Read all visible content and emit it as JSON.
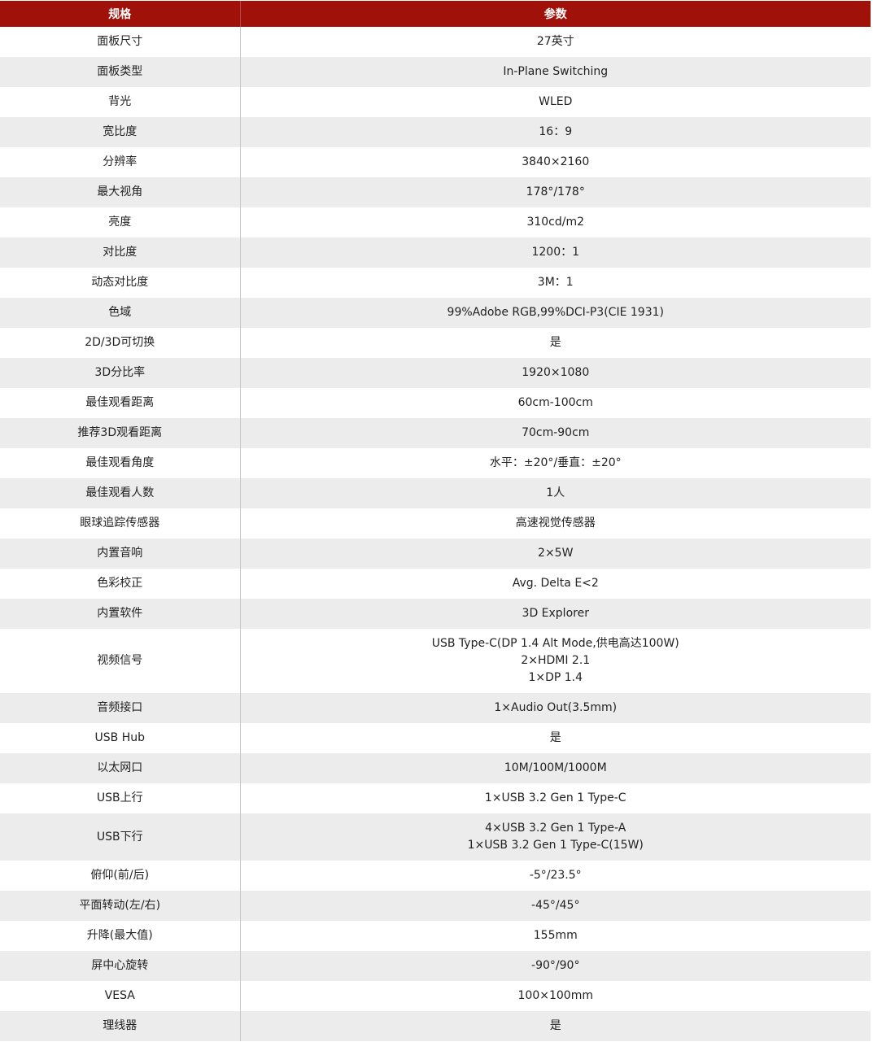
{
  "header": {
    "spec": "规格",
    "param": "参数"
  },
  "colors": {
    "header_bg": "#a01109",
    "alt_row_bg": "#ececec"
  },
  "rows": [
    {
      "label": "面板尺寸",
      "values": [
        "27英寸"
      ]
    },
    {
      "label": "面板类型",
      "values": [
        "In-Plane Switching"
      ]
    },
    {
      "label": "背光",
      "values": [
        "WLED"
      ]
    },
    {
      "label": "宽比度",
      "values": [
        "16：9"
      ]
    },
    {
      "label": "分辨率",
      "values": [
        "3840×2160"
      ]
    },
    {
      "label": "最大视角",
      "values": [
        "178°/178°"
      ]
    },
    {
      "label": "亮度",
      "values": [
        "310cd/m2"
      ]
    },
    {
      "label": "对比度",
      "values": [
        "1200：1"
      ]
    },
    {
      "label": "动态对比度",
      "values": [
        "3M：1"
      ]
    },
    {
      "label": "色域",
      "values": [
        "99%Adobe RGB,99%DCI-P3(CIE 1931)"
      ]
    },
    {
      "label": "2D/3D可切换",
      "values": [
        "是"
      ]
    },
    {
      "label": "3D分比率",
      "values": [
        "1920×1080"
      ]
    },
    {
      "label": "最佳观看距离",
      "values": [
        "60cm-100cm"
      ]
    },
    {
      "label": "推荐3D观看距离",
      "values": [
        "70cm-90cm"
      ]
    },
    {
      "label": "最佳观看角度",
      "values": [
        "水平：±20°/垂直：±20°"
      ]
    },
    {
      "label": "最佳观看人数",
      "values": [
        "1人"
      ]
    },
    {
      "label": "眼球追踪传感器",
      "values": [
        "高速视觉传感器"
      ]
    },
    {
      "label": "内置音响",
      "values": [
        "2×5W"
      ]
    },
    {
      "label": "色彩校正",
      "values": [
        "Avg. Delta E<2"
      ]
    },
    {
      "label": "内置软件",
      "values": [
        "3D Explorer"
      ]
    },
    {
      "label": "视频信号",
      "values": [
        "USB Type-C(DP 1.4 Alt Mode,供电高达100W)",
        "2×HDMI 2.1",
        "1×DP 1.4"
      ]
    },
    {
      "label": "音频接口",
      "values": [
        "1×Audio Out(3.5mm)"
      ]
    },
    {
      "label": "USB Hub",
      "values": [
        "是"
      ]
    },
    {
      "label": "以太网口",
      "values": [
        "10M/100M/1000M"
      ]
    },
    {
      "label": "USB上行",
      "values": [
        "1×USB 3.2 Gen 1 Type-C"
      ]
    },
    {
      "label": "USB下行",
      "values": [
        "4×USB 3.2 Gen 1 Type-A",
        "1×USB 3.2 Gen 1 Type-C(15W)"
      ]
    },
    {
      "label": "俯仰(前/后)",
      "values": [
        "-5°/23.5°"
      ]
    },
    {
      "label": "平面转动(左/右)",
      "values": [
        "-45°/45°"
      ]
    },
    {
      "label": "升降(最大值)",
      "values": [
        "155mm"
      ]
    },
    {
      "label": "屏中心旋转",
      "values": [
        "-90°/90°"
      ]
    },
    {
      "label": "VESA",
      "values": [
        "100×100mm"
      ]
    },
    {
      "label": "理线器",
      "values": [
        "是"
      ]
    }
  ]
}
